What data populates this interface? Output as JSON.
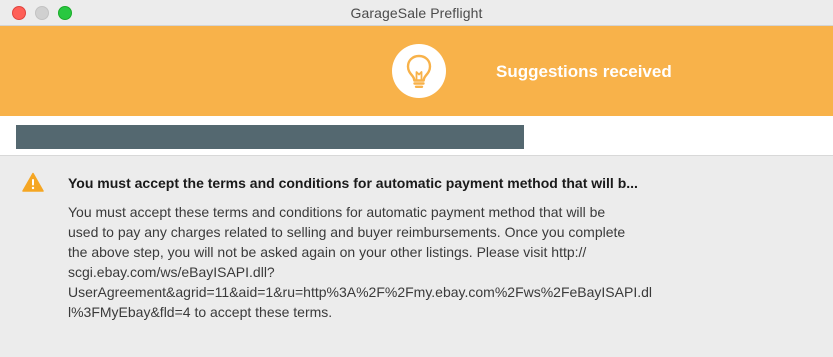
{
  "window": {
    "title": "GarageSale Preflight"
  },
  "header": {
    "status_text": "Suggestions received",
    "icon": "lightbulb-icon",
    "background_color": "#f8b24a"
  },
  "listing": {
    "title_redacted": true
  },
  "message": {
    "icon": "warning-icon",
    "title": "You must accept the terms and conditions for automatic payment method that will b...",
    "body_lines": [
      "You must accept these terms and conditions for automatic payment method that will be",
      "used to pay any charges related to selling and buyer reimbursements. Once you complete",
      "the above step, you will not be asked again on your other listings.  Please visit http://",
      "scgi.ebay.com/ws/eBayISAPI.dll?",
      "UserAgreement&agrid=11&aid=1&ru=http%3A%2F%2Fmy.ebay.com%2Fws%2FeBayISAPI.dl",
      "l%3FMyEbay&fld=4 to accept these terms."
    ]
  }
}
